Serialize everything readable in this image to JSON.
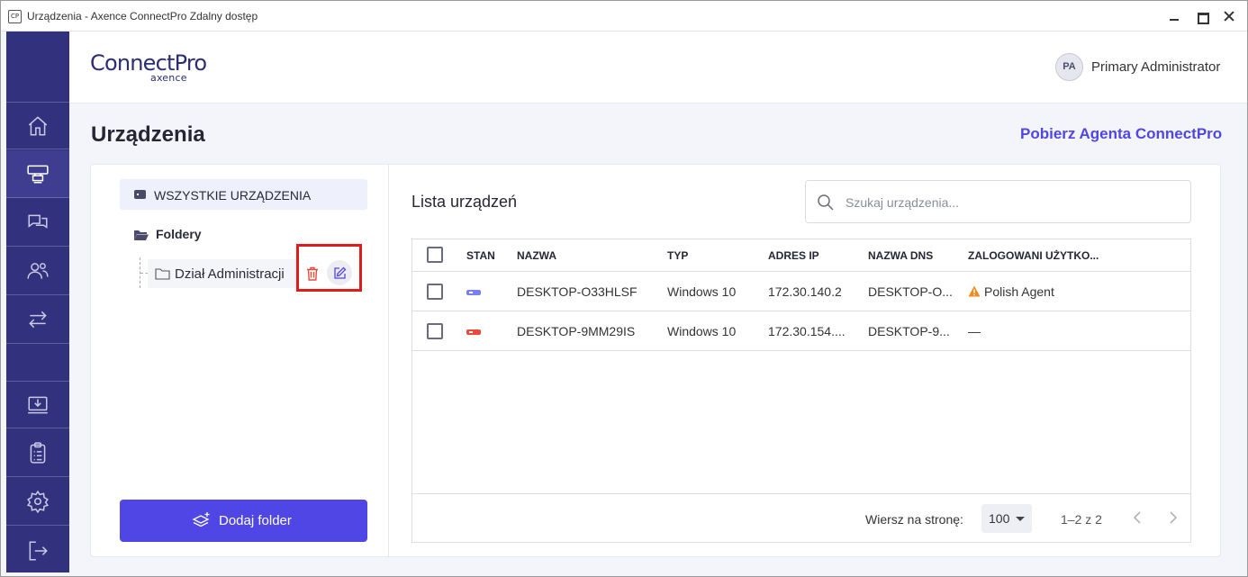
{
  "window": {
    "icon_text": "CP",
    "title": "Urządzenia - Axence ConnectPro Zdalny dostęp"
  },
  "brand": {
    "logo": "ConnectPro",
    "sub": "axence",
    "accent": "#5046e5",
    "sidebar_color": "#32317e"
  },
  "user": {
    "initials": "PA",
    "name": "Primary Administrator"
  },
  "sidebar": {
    "items": [
      {
        "name": "home-icon",
        "active": false
      },
      {
        "name": "devices-icon",
        "active": true
      },
      {
        "name": "chat-icon",
        "active": false
      },
      {
        "name": "users-icon",
        "active": false
      },
      {
        "name": "transfer-icon",
        "active": false
      },
      {
        "name": "download-icon",
        "active": false
      },
      {
        "name": "clipboard-icon",
        "active": false
      },
      {
        "name": "settings-icon",
        "active": false
      },
      {
        "name": "logout-icon",
        "active": false
      }
    ]
  },
  "page": {
    "title": "Urządzenia",
    "agent_link": "Pobierz Agenta ConnectPro"
  },
  "folders": {
    "all_devices": "WSZYSTKIE URZĄDZENIA",
    "folders_label": "Foldery",
    "items": [
      {
        "label": "Dział Administracji"
      }
    ],
    "add_button": "Dodaj folder"
  },
  "device_list": {
    "title": "Lista urządzeń",
    "search_placeholder": "Szukaj urządzenia...",
    "columns": [
      "STAN",
      "NAZWA",
      "TYP",
      "ADRES IP",
      "NAZWA DNS",
      "ZALOGOWANI UŻYTKO..."
    ],
    "rows": [
      {
        "status": "online",
        "status_color": "#7b7ff0",
        "name": "DESKTOP-O33HLSF",
        "type": "Windows 10",
        "ip": "172.30.140.2",
        "dns": "DESKTOP-O...",
        "users": "Polish Agent",
        "warning": true
      },
      {
        "status": "offline",
        "status_color": "#e84b3c",
        "name": "DESKTOP-9MM29IS",
        "type": "Windows 10",
        "ip": "172.30.154....",
        "dns": "DESKTOP-9...",
        "users": "—",
        "warning": false
      }
    ],
    "footer": {
      "rows_per_page_label": "Wiersz na stronę:",
      "rows_per_page_value": "100",
      "range": "1–2 z 2"
    }
  }
}
